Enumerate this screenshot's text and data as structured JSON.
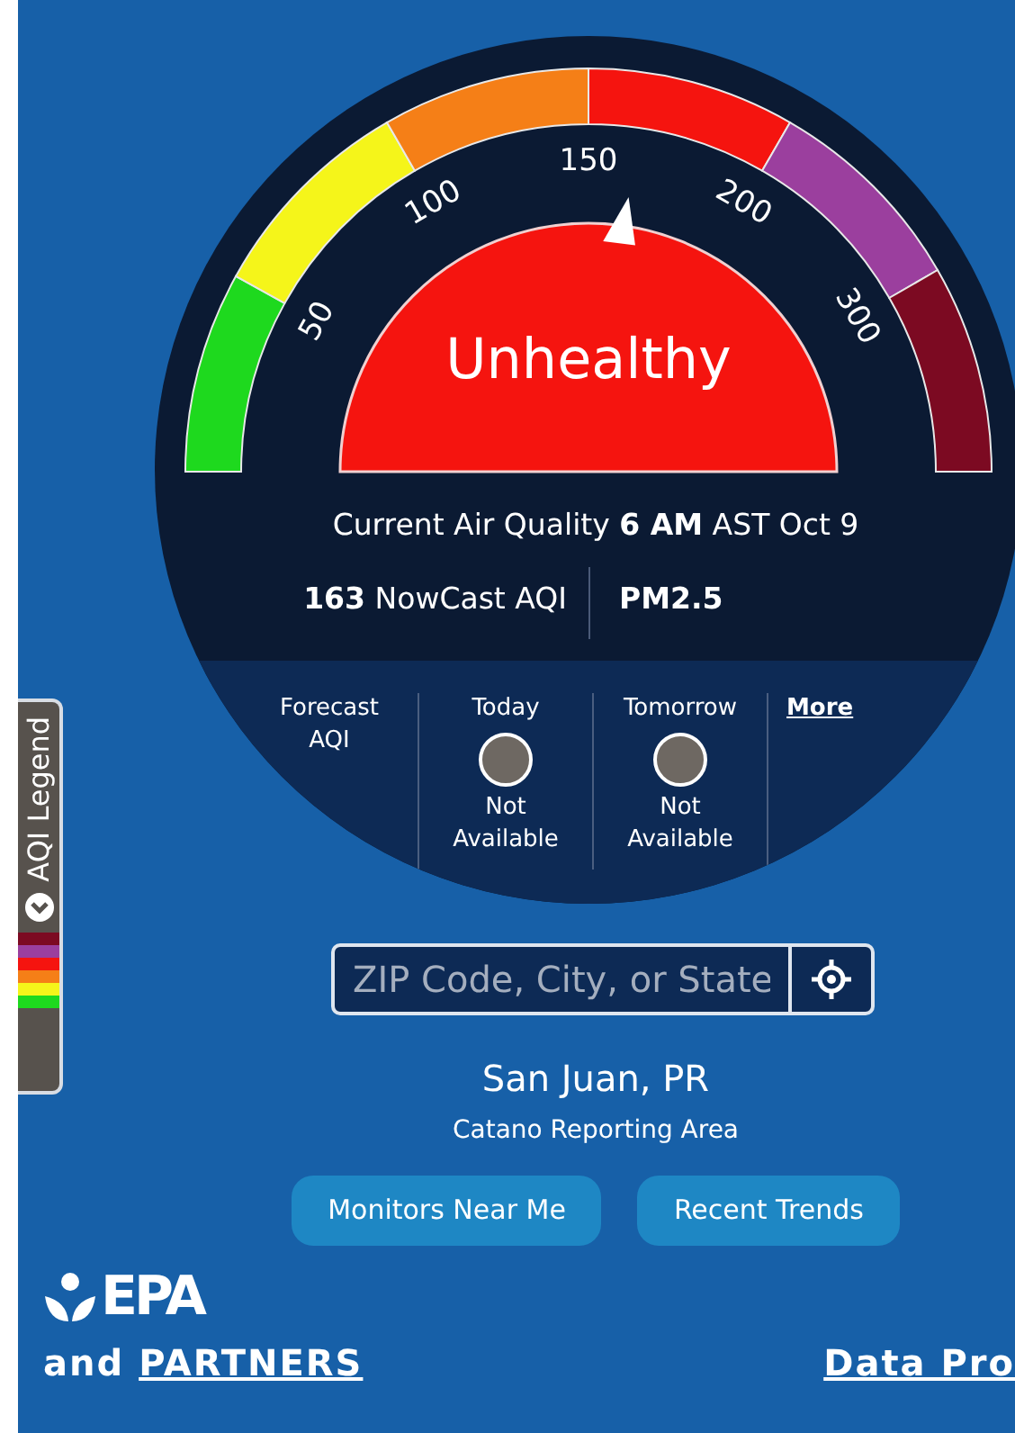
{
  "gauge": {
    "bands": [
      {
        "color": "#1ed91e"
      },
      {
        "color": "#f5f51a"
      },
      {
        "color": "#f57f17"
      },
      {
        "color": "#f5140f"
      },
      {
        "color": "#9b3f9e"
      },
      {
        "color": "#7c0a22"
      }
    ],
    "ticks": [
      "50",
      "100",
      "150",
      "200",
      "300"
    ],
    "level": 0.54,
    "category": "Unhealthy"
  },
  "current": {
    "heading": "Current Air Quality **6 AM** AST Oct 9",
    "aqi": "**163** NowCast AQI",
    "pollutant": "PM2.5"
  },
  "forecast": {
    "label": "Forecast AQI",
    "days": [
      {
        "day": "Today",
        "color": "#6e6862",
        "status": "Not Available"
      },
      {
        "day": "Tomorrow",
        "color": "#6e6862",
        "status": "Not Available"
      }
    ],
    "more": "More"
  },
  "legend_tab": {
    "label": "AQI Legend",
    "swatches": [
      {
        "color": "#7c0a22"
      },
      {
        "color": "#9b3f9e"
      },
      {
        "color": "#f5140f"
      },
      {
        "color": "#f57f17"
      },
      {
        "color": "#f5f51a"
      },
      {
        "color": "#1ed91e"
      }
    ]
  },
  "search": {
    "placeholder": "ZIP Code, City, or State"
  },
  "location": {
    "city": "San Juan, PR",
    "area": "Catano Reporting Area"
  },
  "buttons": [
    "Monitors Near Me",
    "Recent Trends"
  ],
  "footer": {
    "logo": "EPA",
    "prefix": "and",
    "partners": "PARTNERS",
    "data": "Data Pro"
  }
}
